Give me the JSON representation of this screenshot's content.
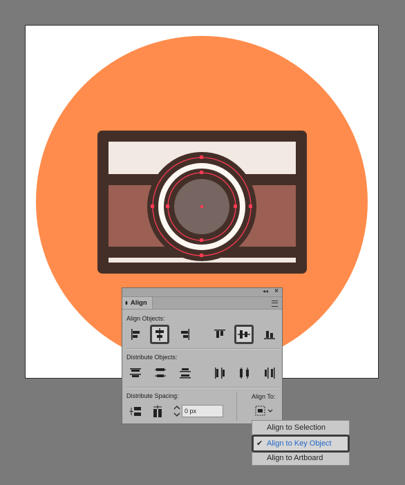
{
  "colors": {
    "canvas_bg": "#7a7a7a",
    "artboard": "#ffffff",
    "circle": "#ff8c4c",
    "camera_outline": "#442f28",
    "camera_top": "#f2e9e3",
    "camera_band": "#9b6053",
    "lens_white": "#fdf7f2",
    "lens_glass": "#766560",
    "selection": "#ff3a55",
    "link_blue": "#2167c7"
  },
  "panel": {
    "tab_label": "Align",
    "align_objects_label": "Align Objects:",
    "distribute_objects_label": "Distribute Objects:",
    "distribute_spacing_label": "Distribute Spacing:",
    "align_to_label": "Align To:",
    "spacing_value": "0 px",
    "selected_buttons": [
      "horizontal-align-center",
      "vertical-align-center"
    ],
    "icons": {
      "collapse": "double-chevron-left-icon",
      "close": "close-icon",
      "menu": "panel-menu-icon"
    }
  },
  "dropdown": {
    "items": [
      {
        "label": "Align to Selection",
        "checked": false
      },
      {
        "label": "Align to Key Object",
        "checked": true
      },
      {
        "label": "Align to Artboard",
        "checked": false
      }
    ]
  }
}
